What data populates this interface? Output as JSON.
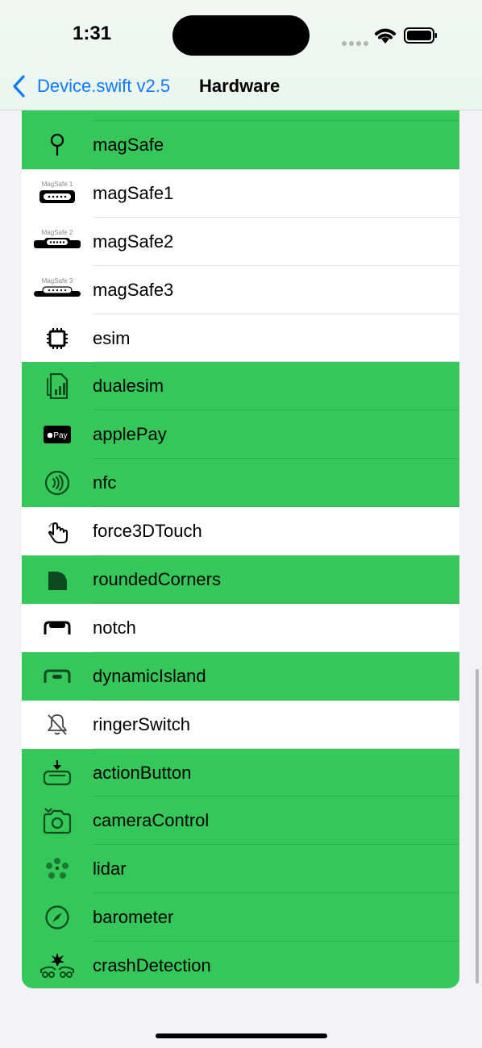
{
  "status": {
    "time": "1:31"
  },
  "nav": {
    "back_label": "Device.swift v2.5",
    "title": "Hardware"
  },
  "colors": {
    "accent": "#0a7aff",
    "green": "#35c759",
    "white": "#ffffff"
  },
  "rows": [
    {
      "label": "magSafe",
      "icon": "pin-icon",
      "highlighted": true
    },
    {
      "label": "magSafe1",
      "icon": "magsafe1-connector-icon",
      "icon_text": "MagSafe 1",
      "highlighted": false
    },
    {
      "label": "magSafe2",
      "icon": "magsafe2-connector-icon",
      "icon_text": "MagSafe 2",
      "highlighted": false
    },
    {
      "label": "magSafe3",
      "icon": "magsafe3-connector-icon",
      "icon_text": "MagSafe 3",
      "highlighted": false
    },
    {
      "label": "esim",
      "icon": "chip-icon",
      "highlighted": false
    },
    {
      "label": "dualesim",
      "icon": "sim-card-icon",
      "highlighted": true
    },
    {
      "label": "applePay",
      "icon": "apple-pay-icon",
      "icon_text": "Pay",
      "highlighted": true
    },
    {
      "label": "nfc",
      "icon": "contactless-icon",
      "highlighted": true
    },
    {
      "label": "force3DTouch",
      "icon": "hand-tap-icon",
      "highlighted": false
    },
    {
      "label": "roundedCorners",
      "icon": "rounded-corner-icon",
      "highlighted": true
    },
    {
      "label": "notch",
      "icon": "notch-icon",
      "highlighted": false
    },
    {
      "label": "dynamicIsland",
      "icon": "dynamic-island-icon",
      "highlighted": true
    },
    {
      "label": "ringerSwitch",
      "icon": "bell-slash-icon",
      "highlighted": false
    },
    {
      "label": "actionButton",
      "icon": "action-button-icon",
      "highlighted": true
    },
    {
      "label": "cameraControl",
      "icon": "camera-icon",
      "highlighted": true
    },
    {
      "label": "lidar",
      "icon": "lidar-dots-icon",
      "highlighted": true
    },
    {
      "label": "barometer",
      "icon": "gauge-icon",
      "highlighted": true
    },
    {
      "label": "crashDetection",
      "icon": "car-crash-icon",
      "highlighted": true
    }
  ]
}
